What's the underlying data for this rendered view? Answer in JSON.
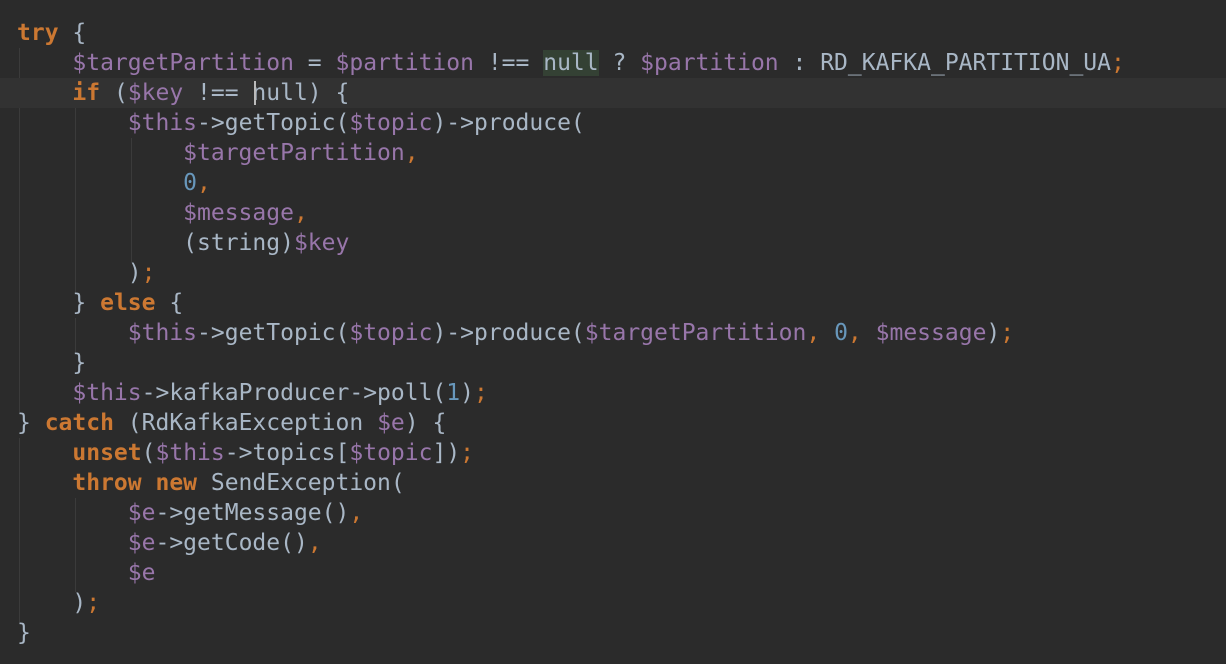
{
  "editor": {
    "language": "PHP",
    "theme_colors": {
      "background": "#2b2b2b",
      "current_line": "#323232",
      "keyword": "#cc7832",
      "variable": "#9876aa",
      "number": "#6897bb",
      "plain": "#a9b7c6",
      "highlight": "#344134"
    },
    "lines": [
      [
        {
          "t": "kw",
          "v": "try"
        },
        {
          "t": "plain",
          "v": " {"
        }
      ],
      [
        {
          "t": "plain",
          "v": "    "
        },
        {
          "t": "var",
          "v": "$targetPartition"
        },
        {
          "t": "plain",
          "v": " = "
        },
        {
          "t": "var",
          "v": "$partition"
        },
        {
          "t": "plain",
          "v": " !== "
        },
        {
          "t": "hl",
          "v": "null"
        },
        {
          "t": "plain",
          "v": " ? "
        },
        {
          "t": "var",
          "v": "$partition"
        },
        {
          "t": "plain",
          "v": " : RD_KAFKA_PARTITION_UA"
        },
        {
          "t": "semi",
          "v": ";"
        }
      ],
      [
        {
          "t": "plain",
          "v": "    "
        },
        {
          "t": "kw",
          "v": "if"
        },
        {
          "t": "plain",
          "v": " ("
        },
        {
          "t": "var",
          "v": "$key"
        },
        {
          "t": "plain",
          "v": " !== null) {"
        }
      ],
      [
        {
          "t": "plain",
          "v": "        "
        },
        {
          "t": "var",
          "v": "$this"
        },
        {
          "t": "plain",
          "v": "->getTopic("
        },
        {
          "t": "var",
          "v": "$topic"
        },
        {
          "t": "plain",
          "v": ")->produce("
        }
      ],
      [
        {
          "t": "plain",
          "v": "            "
        },
        {
          "t": "var",
          "v": "$targetPartition"
        },
        {
          "t": "semi",
          "v": ","
        }
      ],
      [
        {
          "t": "plain",
          "v": "            "
        },
        {
          "t": "num",
          "v": "0"
        },
        {
          "t": "semi",
          "v": ","
        }
      ],
      [
        {
          "t": "plain",
          "v": "            "
        },
        {
          "t": "var",
          "v": "$message"
        },
        {
          "t": "semi",
          "v": ","
        }
      ],
      [
        {
          "t": "plain",
          "v": "            (string)"
        },
        {
          "t": "var",
          "v": "$key"
        }
      ],
      [
        {
          "t": "plain",
          "v": "        )"
        },
        {
          "t": "semi",
          "v": ";"
        }
      ],
      [
        {
          "t": "plain",
          "v": "    } "
        },
        {
          "t": "kw",
          "v": "else"
        },
        {
          "t": "plain",
          "v": " {"
        }
      ],
      [
        {
          "t": "plain",
          "v": "        "
        },
        {
          "t": "var",
          "v": "$this"
        },
        {
          "t": "plain",
          "v": "->getTopic("
        },
        {
          "t": "var",
          "v": "$topic"
        },
        {
          "t": "plain",
          "v": ")->produce("
        },
        {
          "t": "var",
          "v": "$targetPartition"
        },
        {
          "t": "semi",
          "v": ","
        },
        {
          "t": "plain",
          "v": " "
        },
        {
          "t": "num",
          "v": "0"
        },
        {
          "t": "semi",
          "v": ","
        },
        {
          "t": "plain",
          "v": " "
        },
        {
          "t": "var",
          "v": "$message"
        },
        {
          "t": "plain",
          "v": ")"
        },
        {
          "t": "semi",
          "v": ";"
        }
      ],
      [
        {
          "t": "plain",
          "v": "    }"
        }
      ],
      [
        {
          "t": "plain",
          "v": "    "
        },
        {
          "t": "var",
          "v": "$this"
        },
        {
          "t": "plain",
          "v": "->kafkaProducer->poll("
        },
        {
          "t": "num",
          "v": "1"
        },
        {
          "t": "plain",
          "v": ")"
        },
        {
          "t": "semi",
          "v": ";"
        }
      ],
      [
        {
          "t": "plain",
          "v": "} "
        },
        {
          "t": "kw",
          "v": "catch"
        },
        {
          "t": "plain",
          "v": " (RdKafkaException "
        },
        {
          "t": "var",
          "v": "$e"
        },
        {
          "t": "plain",
          "v": ") {"
        }
      ],
      [
        {
          "t": "plain",
          "v": "    "
        },
        {
          "t": "kw",
          "v": "unset"
        },
        {
          "t": "plain",
          "v": "("
        },
        {
          "t": "var",
          "v": "$this"
        },
        {
          "t": "plain",
          "v": "->topics["
        },
        {
          "t": "var",
          "v": "$topic"
        },
        {
          "t": "plain",
          "v": "])"
        },
        {
          "t": "semi",
          "v": ";"
        }
      ],
      [
        {
          "t": "plain",
          "v": "    "
        },
        {
          "t": "kw",
          "v": "throw new"
        },
        {
          "t": "plain",
          "v": " SendException("
        }
      ],
      [
        {
          "t": "plain",
          "v": "        "
        },
        {
          "t": "var",
          "v": "$e"
        },
        {
          "t": "plain",
          "v": "->getMessage()"
        },
        {
          "t": "semi",
          "v": ","
        }
      ],
      [
        {
          "t": "plain",
          "v": "        "
        },
        {
          "t": "var",
          "v": "$e"
        },
        {
          "t": "plain",
          "v": "->getCode()"
        },
        {
          "t": "semi",
          "v": ","
        }
      ],
      [
        {
          "t": "plain",
          "v": "        "
        },
        {
          "t": "var",
          "v": "$e"
        }
      ],
      [
        {
          "t": "plain",
          "v": "    )"
        },
        {
          "t": "semi",
          "v": ";"
        }
      ],
      [
        {
          "t": "plain",
          "v": "}"
        }
      ]
    ]
  }
}
